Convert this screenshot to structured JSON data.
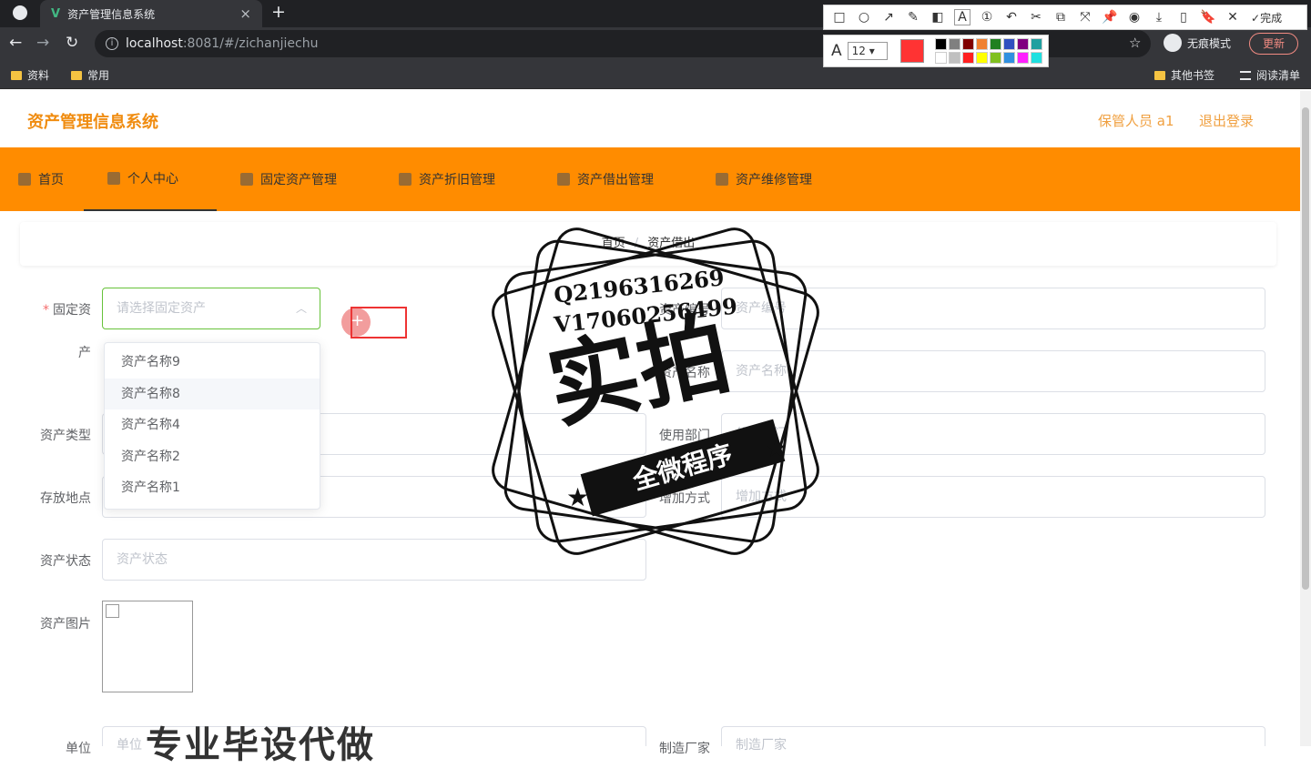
{
  "browser": {
    "tab_title": "资产管理信息系统",
    "tab_logo": "V",
    "close_tab": "×",
    "new_tab": "+",
    "url_host": "localhost",
    "url_rest": ":8081/#/zichanjiechu",
    "info_glyph": "i",
    "star_glyph": "☆",
    "incognito_label": "无痕模式",
    "update_label": "更新",
    "back_glyph": "←",
    "forward_glyph": "→",
    "reload_glyph": "↻",
    "bookmarks": [
      "资料",
      "常用"
    ],
    "bookmarks_right": [
      "其他书签",
      "阅读清单"
    ]
  },
  "screenshot_toolbar": {
    "tools": [
      "□",
      "○",
      "↗",
      "✎",
      "◧",
      "A",
      "①",
      "↶",
      "✂",
      "⧉",
      "⤧",
      "📌",
      "◉",
      "⤓",
      "▯",
      "🔖",
      "✕"
    ],
    "done_label": "完成",
    "check_glyph": "✓",
    "font_glyph": "A",
    "font_size": "12",
    "caret": "▾",
    "current_color": "#ff3333",
    "palette": [
      "#000000",
      "#808080",
      "#800000",
      "#f08030",
      "#208020",
      "#3050c0",
      "#800080",
      "#20a0a0",
      "#ffffff",
      "#c0c0c0",
      "#ff2020",
      "#ffff00",
      "#80c020",
      "#3090e0",
      "#ff20ff",
      "#20e0e0"
    ]
  },
  "app": {
    "title": "资产管理信息系统",
    "user": "保管人员 a1",
    "logout": "退出登录",
    "accent": "#ff8c00",
    "menu": [
      "首页",
      "个人中心",
      "固定资产管理",
      "资产折旧管理",
      "资产借出管理",
      "资产维修管理"
    ]
  },
  "breadcrumb": {
    "home": "首页",
    "sep": "/",
    "current": "资产借出"
  },
  "form": {
    "fixed_asset_label": "固定资",
    "fixed_asset_label2": "产",
    "required_mark": "*",
    "fixed_asset_placeholder": "请选择固定资产",
    "select_arrow": "︿",
    "asset_no_label": "资产编号",
    "asset_no_placeholder": "资产编号",
    "asset_name_label": "资产名称",
    "asset_name_placeholder": "资产名称",
    "asset_type_label": "资产类型",
    "dept_label": "使用部门",
    "dept_placeholder": "使用部门",
    "location_label": "存放地点",
    "add_method_label": "增加方式",
    "add_method_placeholder": "增加方式",
    "status_label": "资产状态",
    "status_placeholder": "资产状态",
    "image_label": "资产图片",
    "unit_label": "单位",
    "unit_placeholder": "单位",
    "maker_label": "制造厂家",
    "maker_placeholder": "制造厂家"
  },
  "dropdown_options": [
    "资产名称9",
    "资产名称8",
    "资产名称4",
    "资产名称2",
    "资产名称1"
  ],
  "watermark": {
    "qq": "Q2196316269",
    "vx": "V17060256499",
    "big": "实拍",
    "banner": "全微程序",
    "star": "★",
    "bottom": "专业毕设代做"
  }
}
